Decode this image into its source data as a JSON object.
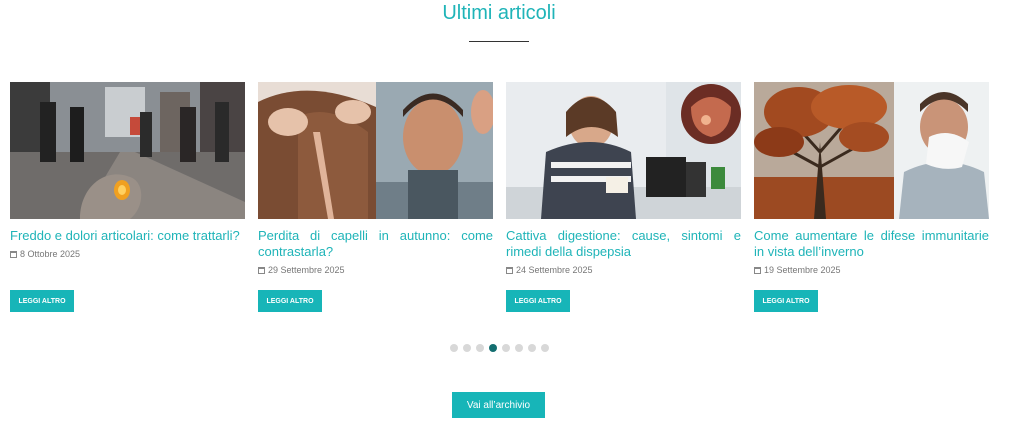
{
  "section": {
    "title": "Ultimi articoli"
  },
  "articles": [
    {
      "title": "Freddo e dolori articolari: come trattarli?",
      "date": "8 Ottobre 2025",
      "button": "LEGGI ALTRO"
    },
    {
      "title": "Perdita di capelli in autunno: come contrastarla?",
      "date": "29 Settembre 2025",
      "button": "LEGGI ALTRO"
    },
    {
      "title": "Cattiva digestione: cause, sintomi e rimedi della dispepsia",
      "date": "24 Settembre 2025",
      "button": "LEGGI ALTRO"
    },
    {
      "title": "Come aumentare le difese immunitarie in vista dell’inverno",
      "date": "19 Settembre 2025",
      "button": "LEGGI ALTRO"
    }
  ],
  "carousel": {
    "total_pages": 8,
    "active_page": 4
  },
  "archive": {
    "label": "Vai all’archivio"
  },
  "colors": {
    "accent": "#1fb4b8",
    "button": "#17b5b8",
    "dot_active": "#136e70",
    "dot_inactive": "#d8d8d8"
  }
}
